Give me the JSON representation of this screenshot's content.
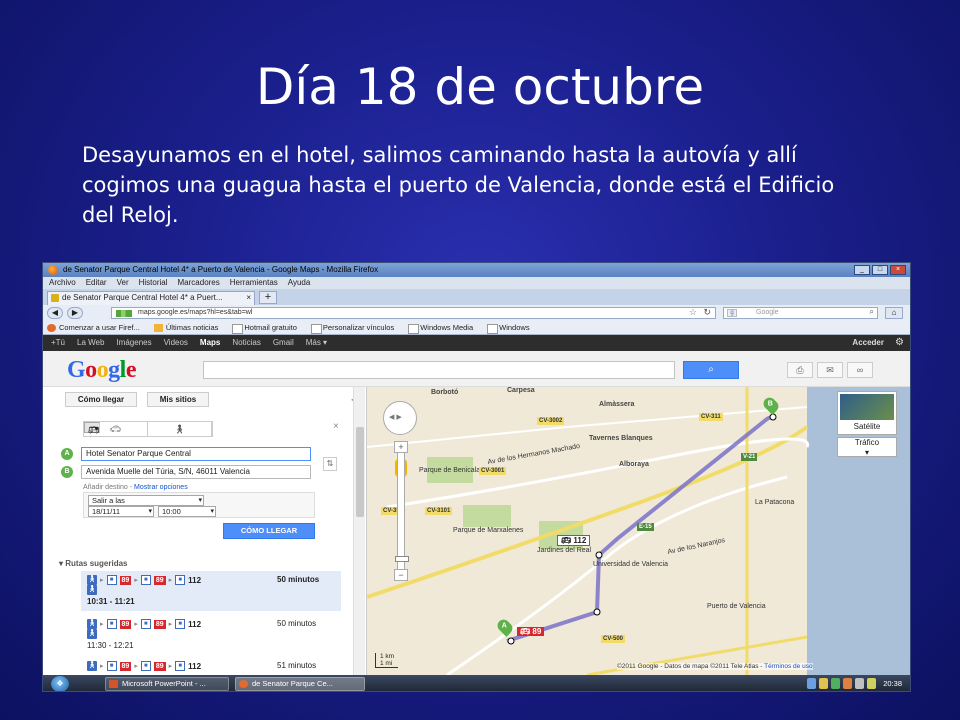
{
  "slide": {
    "title": "Día 18 de octubre",
    "body": "Desayunamos en el hotel, salimos caminando hasta la autovía y allí cogimos una guagua hasta el puerto de Valencia, donde está el Edificio del Reloj."
  },
  "browser": {
    "window_title": "de Senator Parque Central Hotel 4* a Puerto de Valencia - Google Maps - Mozilla Firefox",
    "menu": [
      "Archivo",
      "Editar",
      "Ver",
      "Historial",
      "Marcadores",
      "Herramientas",
      "Ayuda"
    ],
    "tab_title": "de Senator Parque Central Hotel 4* a Puert...",
    "url": "maps.google.es/maps?hl=es&tab=wl",
    "search_placeholder": "Google",
    "bookmarks": [
      "Comenzar a usar Firef...",
      "Últimas noticias",
      "Hotmail gratuito",
      "Personalizar vínculos",
      "Windows Media",
      "Windows"
    ]
  },
  "google_bar": {
    "items": [
      "+Tú",
      "La Web",
      "Imágenes",
      "Videos",
      "Maps",
      "Noticias",
      "Gmail",
      "Más ▾"
    ],
    "active": "Maps",
    "signin": "Acceder",
    "logo": "Google"
  },
  "panel": {
    "buttons": [
      "Cómo llegar",
      "Mis sitios"
    ],
    "origin_marker": "A",
    "dest_marker": "B",
    "origin": "Hotel Senator Parque Central",
    "destination": "Avenida Muelle del Túria, S/N, 46011 Valencia",
    "add_destination": "Añadir destino",
    "separator": "-",
    "show_options": "Mostrar opciones",
    "depart_mode": "Salir a las",
    "date": "18/11/11",
    "time": "10:00",
    "go_button": "CÓMO LLEGAR",
    "routes_header": "Rutas sugeridas",
    "bus_line_a": "89",
    "bus_line_b": "112",
    "routes": [
      {
        "duration": "50 minutos",
        "times": "10:31 - 11:21"
      },
      {
        "duration": "50 minutos",
        "times": "11:30 - 12:21"
      },
      {
        "duration": "51 minutos",
        "times": ""
      }
    ]
  },
  "map": {
    "places": [
      "Carpesa",
      "Borbotó",
      "Almàssera",
      "Tavernes Blanques",
      "Alboraya",
      "Parque de Benicalap",
      "Parque de Marxalenes",
      "Jardines del Real",
      "Universidad de Valencia",
      "La Patacona",
      "Av de los Hermanos Machado",
      "Av de los Naranjos",
      "Puerto de Valencia"
    ],
    "roads": [
      "CV-3002",
      "CV-311",
      "V-21",
      "CV-3001",
      "CV-3101",
      "CV-35",
      "E-15",
      "V-30",
      "CV-500"
    ],
    "layer_button": "Satélite",
    "traffic_button": "Tráfico",
    "scale_km": "1 km",
    "scale_mi": "1 mi",
    "attribution": "©2011 Google - Datos de mapa ©2011 Tele Atlas -",
    "terms": "Términos de uso",
    "marker_a": "A",
    "marker_b": "B"
  },
  "taskbar": {
    "start": "❖",
    "items": [
      "Microsoft PowerPoint - ...",
      "de Senator Parque Ce..."
    ],
    "clock": "20:38"
  },
  "colors": {
    "slide_bg": "#1a1f8c",
    "google_bar": "#2d2d2d",
    "blue_button": "#4d8ef8",
    "bus_red": "#d8282f",
    "route_line": "#7a72c9"
  }
}
